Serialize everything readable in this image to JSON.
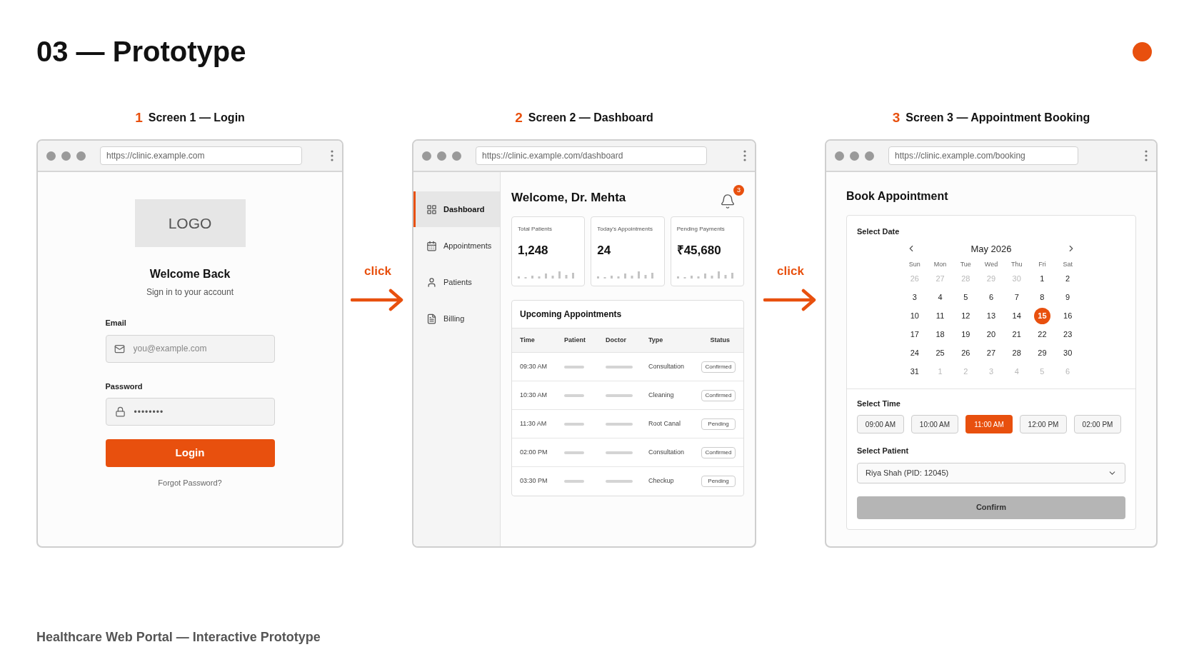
{
  "title": "03 — Prototype",
  "screens": [
    {
      "number": "1",
      "label": "Screen 1 — Login",
      "url": "https://clinic.example.com",
      "login": {
        "logo": "LOGO",
        "heading": "Welcome Back",
        "subheading": "Sign in to your account",
        "email_label": "Email",
        "email_placeholder": "you@example.com",
        "password_label": "Password",
        "password_value": "••••••••",
        "button": "Login",
        "forgot": "Forgot Password?"
      }
    },
    {
      "number": "2",
      "label": "Screen 2 — Dashboard",
      "url": "https://clinic.example.com/dashboard",
      "dashboard": {
        "sidebar": [
          {
            "label": "Dashboard",
            "selected": true
          },
          {
            "label": "Appointments",
            "selected": false
          },
          {
            "label": "Patients",
            "selected": false
          },
          {
            "label": "Billing",
            "selected": false
          }
        ],
        "welcome": "Welcome, Dr. Mehta",
        "notifications": "3",
        "stats": [
          {
            "label": "Total Patients",
            "value": "1,248"
          },
          {
            "label": "Today's Appointments",
            "value": "24"
          },
          {
            "label": "Pending Payments",
            "value": "₹45,680"
          }
        ],
        "table_title": "Upcoming Appointments",
        "columns": [
          "Time",
          "Patient",
          "Doctor",
          "Type",
          "Status"
        ],
        "rows": [
          {
            "time": "09:30 AM",
            "type": "Consultation",
            "status": "Confirmed"
          },
          {
            "time": "10:30 AM",
            "type": "Cleaning",
            "status": "Confirmed"
          },
          {
            "time": "11:30 AM",
            "type": "Root Canal",
            "status": "Pending"
          },
          {
            "time": "02:00 PM",
            "type": "Consultation",
            "status": "Confirmed"
          },
          {
            "time": "03:30 PM",
            "type": "Checkup",
            "status": "Pending"
          }
        ]
      }
    },
    {
      "number": "3",
      "label": "Screen 3 — Appointment Booking",
      "url": "https://clinic.example.com/booking",
      "booking": {
        "heading": "Book Appointment",
        "date_label": "Select Date",
        "month": "May 2026",
        "weekdays": [
          "Sun",
          "Mon",
          "Tue",
          "Wed",
          "Thu",
          "Fri",
          "Sat"
        ],
        "weeks": [
          [
            {
              "day": "26",
              "muted": true,
              "selected": false
            },
            {
              "day": "27",
              "muted": true,
              "selected": false
            },
            {
              "day": "28",
              "muted": true,
              "selected": false
            },
            {
              "day": "29",
              "muted": true,
              "selected": false
            },
            {
              "day": "30",
              "muted": true,
              "selected": false
            },
            {
              "day": "1",
              "muted": false,
              "selected": false
            },
            {
              "day": "2",
              "muted": false,
              "selected": false
            }
          ],
          [
            {
              "day": "3",
              "muted": false,
              "selected": false
            },
            {
              "day": "4",
              "muted": false,
              "selected": false
            },
            {
              "day": "5",
              "muted": false,
              "selected": false
            },
            {
              "day": "6",
              "muted": false,
              "selected": false
            },
            {
              "day": "7",
              "muted": false,
              "selected": false
            },
            {
              "day": "8",
              "muted": false,
              "selected": false
            },
            {
              "day": "9",
              "muted": false,
              "selected": false
            }
          ],
          [
            {
              "day": "10",
              "muted": false,
              "selected": false
            },
            {
              "day": "11",
              "muted": false,
              "selected": false
            },
            {
              "day": "12",
              "muted": false,
              "selected": false
            },
            {
              "day": "13",
              "muted": false,
              "selected": false
            },
            {
              "day": "14",
              "muted": false,
              "selected": false
            },
            {
              "day": "15",
              "muted": false,
              "selected": true
            },
            {
              "day": "16",
              "muted": false,
              "selected": false
            }
          ],
          [
            {
              "day": "17",
              "muted": false,
              "selected": false
            },
            {
              "day": "18",
              "muted": false,
              "selected": false
            },
            {
              "day": "19",
              "muted": false,
              "selected": false
            },
            {
              "day": "20",
              "muted": false,
              "selected": false
            },
            {
              "day": "21",
              "muted": false,
              "selected": false
            },
            {
              "day": "22",
              "muted": false,
              "selected": false
            },
            {
              "day": "23",
              "muted": false,
              "selected": false
            }
          ],
          [
            {
              "day": "24",
              "muted": false,
              "selected": false
            },
            {
              "day": "25",
              "muted": false,
              "selected": false
            },
            {
              "day": "26",
              "muted": false,
              "selected": false
            },
            {
              "day": "27",
              "muted": false,
              "selected": false
            },
            {
              "day": "28",
              "muted": false,
              "selected": false
            },
            {
              "day": "29",
              "muted": false,
              "selected": false
            },
            {
              "day": "30",
              "muted": false,
              "selected": false
            }
          ],
          [
            {
              "day": "31",
              "muted": false,
              "selected": false
            },
            {
              "day": "1",
              "muted": true,
              "selected": false
            },
            {
              "day": "2",
              "muted": true,
              "selected": false
            },
            {
              "day": "3",
              "muted": true,
              "selected": false
            },
            {
              "day": "4",
              "muted": true,
              "selected": false
            },
            {
              "day": "5",
              "muted": true,
              "selected": false
            },
            {
              "day": "6",
              "muted": true,
              "selected": false
            }
          ]
        ],
        "time_label": "Select Time",
        "times": [
          {
            "label": "09:00 AM",
            "selected": false
          },
          {
            "label": "10:00 AM",
            "selected": false
          },
          {
            "label": "11:00 AM",
            "selected": true
          },
          {
            "label": "12:00 PM",
            "selected": false
          },
          {
            "label": "02:00 PM",
            "selected": false
          }
        ],
        "patient_label": "Select Patient",
        "patient_value": "Riya Shah (PID: 12045)",
        "button": "Confirm"
      }
    }
  ],
  "connectors": [
    {
      "label": "click"
    },
    {
      "label": "click"
    }
  ],
  "footer": "Healthcare Web Portal — Interactive Prototype"
}
